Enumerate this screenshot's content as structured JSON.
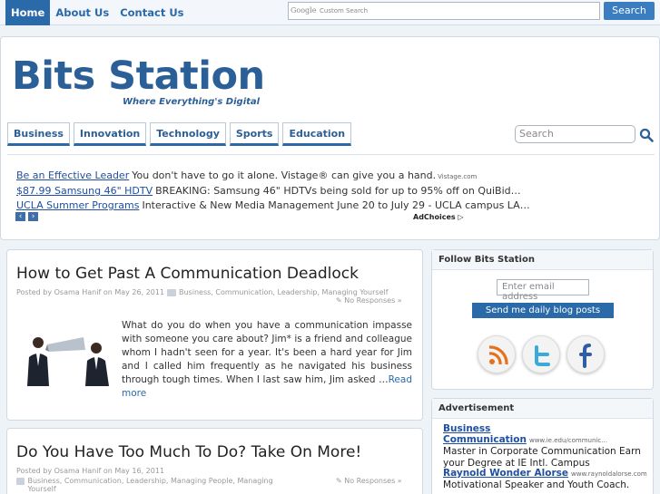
{
  "topnav": {
    "items": [
      "Home",
      "About Us",
      "Contact Us"
    ]
  },
  "google_search": {
    "logo": "Google",
    "placeholder": "Custom Search",
    "button": "Search"
  },
  "header": {
    "logo": "Bits Station",
    "tagline": "Where Everything's Digital"
  },
  "categories": [
    "Business",
    "Innovation",
    "Technology",
    "Sports",
    "Education"
  ],
  "header_search": {
    "placeholder": "Search"
  },
  "ads": [
    {
      "link": "Be an Effective Leader",
      "text": "You don't have to go it alone. Vistage® can give you a hand.",
      "url": "Vistage.com"
    },
    {
      "link": "$87.99 Samsung 46\" HDTV",
      "text": "BREAKING: Samsung 46\" HDTVs being sold for up to 95% off on QuiBid…",
      "url": ""
    },
    {
      "link": "UCLA Summer Programs",
      "text": "Interactive & New Media Management June 20 to July 29 - UCLA campus LA…",
      "url": ""
    }
  ],
  "adchoices": "AdChoices ▷",
  "posts": [
    {
      "title": "How to Get Past A Communication Deadlock",
      "meta": "Posted by Osama Hanif on May 26, 2011",
      "cats": "Business, Communication, Leadership, Managing Yourself",
      "responses": "No Responses »",
      "body": "What do you do when you have a communication impasse with someone you care about? Jim* is a friend and colleague whom I hadn't seen for a year. It's been a hard year for Jim and I called him frequently as he navigated his business through tough times. When I last saw him, Jim asked …",
      "read_more": "Read more"
    },
    {
      "title": "Do You Have Too Much To Do? Take On More!",
      "meta": "Posted by Osama Hanif on May 16, 2011",
      "cats": "Business, Communication, Leadership, Managing People, Managing Yourself",
      "responses": "No Responses »"
    }
  ],
  "sidebar": {
    "follow_title": "Follow Bits Station",
    "email_placeholder": "Enter email address",
    "digest_button": "Send me daily blog posts digest",
    "ad_title": "Advertisement",
    "ads": [
      {
        "link": "Business Communication",
        "url": "www.ie.edu/communic…",
        "desc": "Master in Corporate Communication Earn your Degree at IE Intl. Campus"
      },
      {
        "link": "Raynold Wonder Alorse",
        "url": "www.raynoldalorse.com",
        "desc": "Motivational Speaker and Youth Coach."
      }
    ]
  },
  "colors": {
    "brand": "#2b5f97",
    "accent": "#2b6aa8",
    "link": "#1f4fa0"
  }
}
